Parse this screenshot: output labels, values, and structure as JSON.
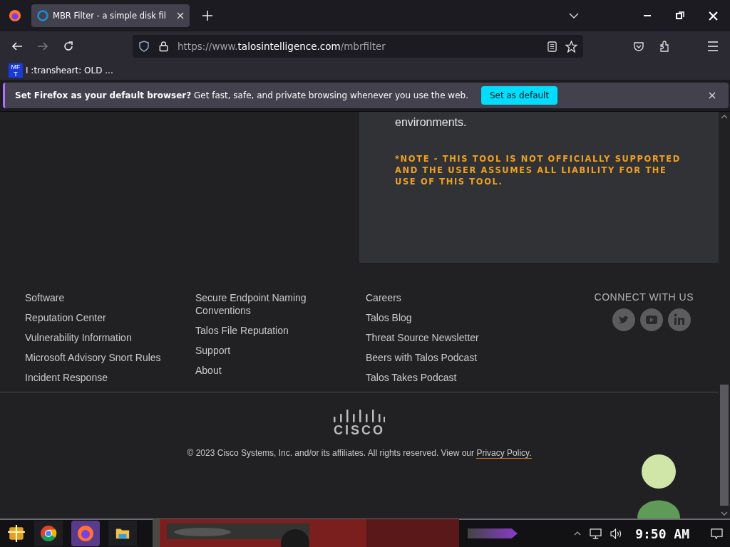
{
  "browser": {
    "tab": {
      "title": "MBR Filter - a simple disk fil",
      "selected": true
    },
    "url": {
      "prefix": "https://www.",
      "domain": "talosintelligence.com",
      "path": "/mbrfilter"
    },
    "bookmarks": [
      {
        "icon_lines": [
          "MF",
          "T"
        ],
        "label": "I :transheart: OLD ..."
      }
    ]
  },
  "notification": {
    "message_bold": "Set Firefox as your default browser?",
    "message": "Get fast, safe, and private browsing whenever you use the web.",
    "button": "Set as default"
  },
  "content": {
    "body_text": "environments.",
    "note": "*NOTE - THIS TOOL IS NOT OFFICIALLY SUPPORTED AND THE USER ASSUMES ALL LIABILITY FOR THE USE OF THIS TOOL."
  },
  "footer": {
    "columns": [
      [
        "Software",
        "Reputation Center",
        "Vulnerability Information",
        "Microsoft Advisory Snort Rules",
        "Incident Response"
      ],
      [
        "Secure Endpoint Naming Conventions",
        "Talos File Reputation",
        "Support",
        "About"
      ],
      [
        "Careers",
        "Talos Blog",
        "Threat Source Newsletter",
        "Beers with Talos Podcast",
        "Talos Takes Podcast"
      ]
    ],
    "connect_heading": "CONNECT WITH US",
    "social": [
      {
        "kind": "twitter"
      },
      {
        "kind": "youtube"
      },
      {
        "kind": "linkedin"
      }
    ],
    "logo_text": "CISCO",
    "copyright": "© 2023 Cisco Systems, Inc. and/or its affiliates. All rights reserved. View our ",
    "privacy_link": "Privacy Policy."
  },
  "taskbar": {
    "apps": [
      {
        "kind": "start"
      },
      {
        "kind": "chrome",
        "selected": false
      },
      {
        "kind": "firefox",
        "selected": true
      },
      {
        "kind": "files",
        "selected": false
      }
    ],
    "clock": "9:50 AM"
  }
}
